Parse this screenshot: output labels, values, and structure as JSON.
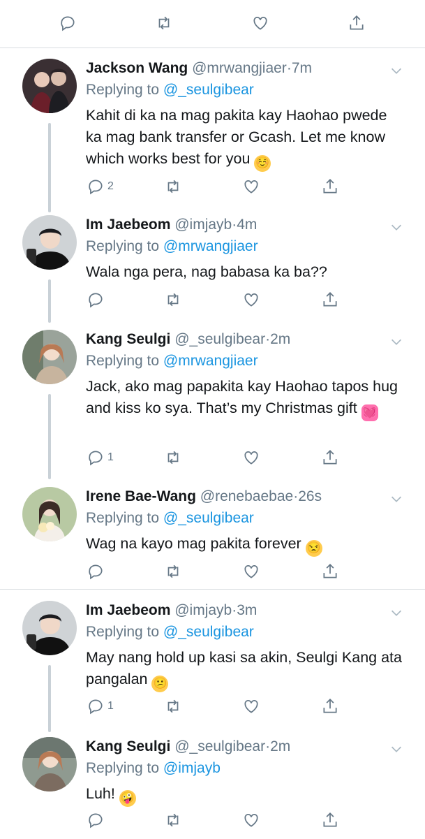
{
  "top_actions": {
    "reply": "reply-icon",
    "retweet": "retweet-icon",
    "like": "heart-icon",
    "share": "share-icon"
  },
  "tweets": [
    {
      "name": "Jackson Wang",
      "handle": "@mrwangjiaer",
      "time": "7m",
      "replying_prefix": "Replying to ",
      "replying_to": "@_seulgibear",
      "text": "Kahit di ka na mag pakita kay Haohao pwede ka mag bank transfer or Gcash. Let me know which works best for you",
      "emoji": "☺️",
      "reply_count": "2"
    },
    {
      "name": "Im Jaebeom",
      "handle": "@imjayb",
      "time": "4m",
      "replying_prefix": "Replying to ",
      "replying_to": "@mrwangjiaer",
      "text": "Wala nga pera, nag babasa ka ba??",
      "emoji": "",
      "reply_count": ""
    },
    {
      "name": "Kang Seulgi",
      "handle": "@_seulgibear",
      "time": "2m",
      "replying_prefix": "Replying to ",
      "replying_to": "@mrwangjiaer",
      "text": "Jack, ako mag papakita kay Haohao tapos hug and kiss ko sya. That’s my Christmas gift",
      "emoji": "💓",
      "reply_count": "1"
    },
    {
      "name": "Irene Bae-Wang",
      "handle": "@renebaebae",
      "time": "26s",
      "replying_prefix": "Replying to ",
      "replying_to": "@_seulgibear",
      "text": "Wag na kayo mag pakita forever",
      "emoji": "😒",
      "reply_count": ""
    },
    {
      "name": "Im Jaebeom",
      "handle": "@imjayb",
      "time": "3m",
      "replying_prefix": "Replying to ",
      "replying_to": "@_seulgibear",
      "text": "May nang hold up kasi sa akin, Seulgi Kang ata pangalan",
      "emoji": "😕",
      "reply_count": "1"
    },
    {
      "name": "Kang Seulgi",
      "handle": "@_seulgibear",
      "time": "2m",
      "replying_prefix": "Replying to ",
      "replying_to": "@imjayb",
      "text": "Luh!",
      "emoji": "🤪",
      "reply_count": ""
    }
  ],
  "separator": "·",
  "colors": {
    "link": "#1b95e0",
    "secondary": "#657786",
    "divider": "#d8dde1"
  }
}
